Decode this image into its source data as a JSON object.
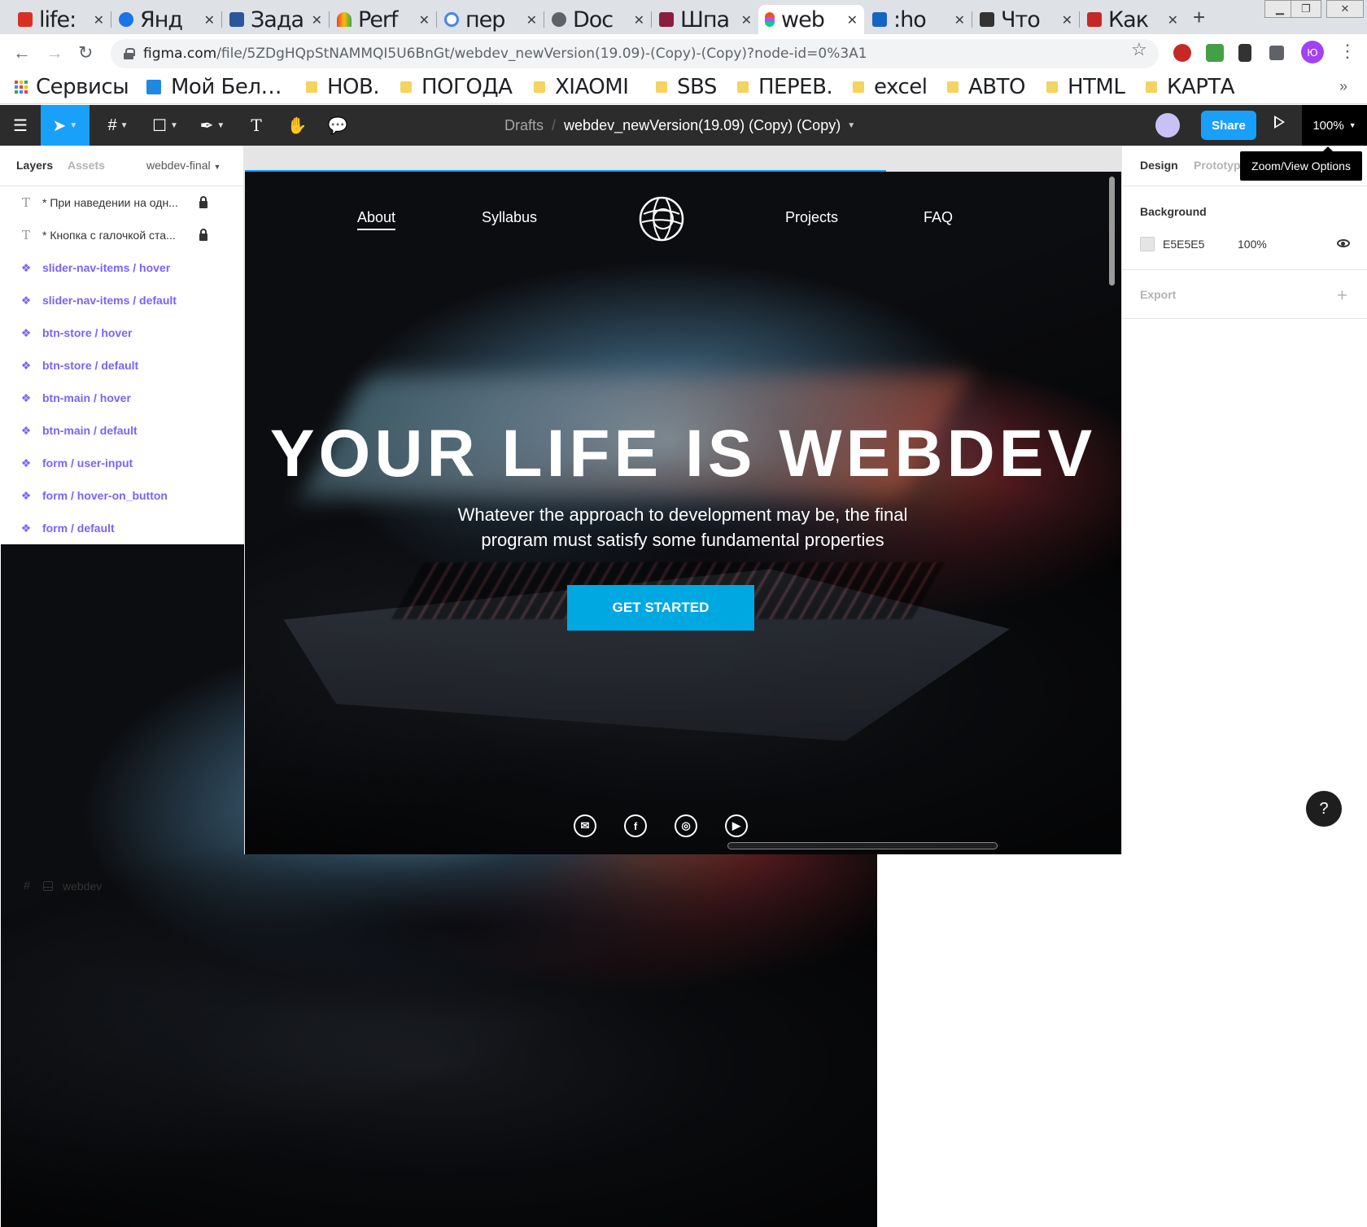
{
  "browser": {
    "tabs": [
      {
        "label": "life:",
        "color": "#d93025"
      },
      {
        "label": "Янд",
        "color": "#1a73e8"
      },
      {
        "label": "Зада",
        "color": "#2b579a"
      },
      {
        "label": "Perf",
        "color": "#ea4335"
      },
      {
        "label": "пер",
        "color": "#4285f4"
      },
      {
        "label": "Doc",
        "color": "#5f6368"
      },
      {
        "label": "Шпа",
        "color": "#8b1e3f"
      },
      {
        "label": "web",
        "color": "#f24e1e"
      },
      {
        "label": ":ho",
        "color": "#1565c0"
      },
      {
        "label": "Что",
        "color": "#333333"
      },
      {
        "label": "Как",
        "color": "#c62828"
      }
    ],
    "new_tab_label": "+",
    "url_host": "figma.com",
    "url_path": "/file/5ZDgHQpStNAMMQI5U6BnGt/webdev_newVersion(19.09)-(Copy)-(Copy)?node-id=0%3A1",
    "profile_initial": "Ю",
    "bookmarks": [
      {
        "label": "Сервисы",
        "type": "apps"
      },
      {
        "label": "Мой Бел…",
        "type": "site"
      },
      {
        "label": "НОВ.",
        "type": "folder"
      },
      {
        "label": "ПОГОДА",
        "type": "folder"
      },
      {
        "label": "XIAOMI",
        "type": "folder"
      },
      {
        "label": "SBS",
        "type": "folder"
      },
      {
        "label": "ПЕРЕВ.",
        "type": "folder"
      },
      {
        "label": "excel",
        "type": "folder"
      },
      {
        "label": "АВТО",
        "type": "folder"
      },
      {
        "label": "HTML",
        "type": "folder"
      },
      {
        "label": "КАРТА",
        "type": "folder"
      }
    ],
    "bookmarks_more": "»"
  },
  "figma": {
    "toolbar": {
      "breadcrumb_drafts": "Drafts",
      "breadcrumb_sep": "/",
      "file_name": "webdev_newVersion(19.09) (Copy) (Copy)",
      "share_label": "Share",
      "zoom_label": "100%",
      "zoom_tooltip": "Zoom/View Options"
    },
    "layers_panel": {
      "tab_layers": "Layers",
      "tab_assets": "Assets",
      "page_name": "webdev-final",
      "layers": [
        {
          "label": "* При наведении на одн...",
          "type": "text",
          "locked": true
        },
        {
          "label": "* Кнопка с галочкой ста...",
          "type": "text",
          "locked": true
        },
        {
          "label": "slider-nav-items / hover",
          "type": "component"
        },
        {
          "label": "slider-nav-items / default",
          "type": "component"
        },
        {
          "label": "btn-store / hover",
          "type": "component"
        },
        {
          "label": "btn-store / default",
          "type": "component"
        },
        {
          "label": "btn-main / hover",
          "type": "component"
        },
        {
          "label": "btn-main / default",
          "type": "component"
        },
        {
          "label": "form / user-input",
          "type": "component"
        },
        {
          "label": "form / hover-on_button",
          "type": "component"
        },
        {
          "label": "form / default",
          "type": "component"
        },
        {
          "label": "webdev",
          "type": "frame"
        }
      ]
    },
    "design_panel": {
      "tab_design": "Design",
      "tab_prototype": "Prototype",
      "background_title": "Background",
      "background_hex": "E5E5E5",
      "background_opacity": "100%",
      "export_title": "Export",
      "help_label": "?"
    },
    "canvas_frame": {
      "nav": {
        "about": "About",
        "syllabus": "Syllabus",
        "projects": "Projects",
        "faq": "FAQ"
      },
      "hero_title": "YOUR LIFE IS WEBDEV",
      "hero_subtitle_line1": "Whatever the approach to development may be, the final",
      "hero_subtitle_line2": "program must satisfy some fundamental properties",
      "cta_label": "GET STARTED",
      "social_icons": [
        "mail-icon",
        "facebook-icon",
        "instagram-icon",
        "youtube-icon"
      ]
    },
    "colors": {
      "figma_dark": "#2c2c2c",
      "accent_blue": "#18a0fb",
      "component_purple": "#7b61ff",
      "cta_blue": "#00a8e1",
      "canvas_bg": "#e5e5e5"
    }
  }
}
